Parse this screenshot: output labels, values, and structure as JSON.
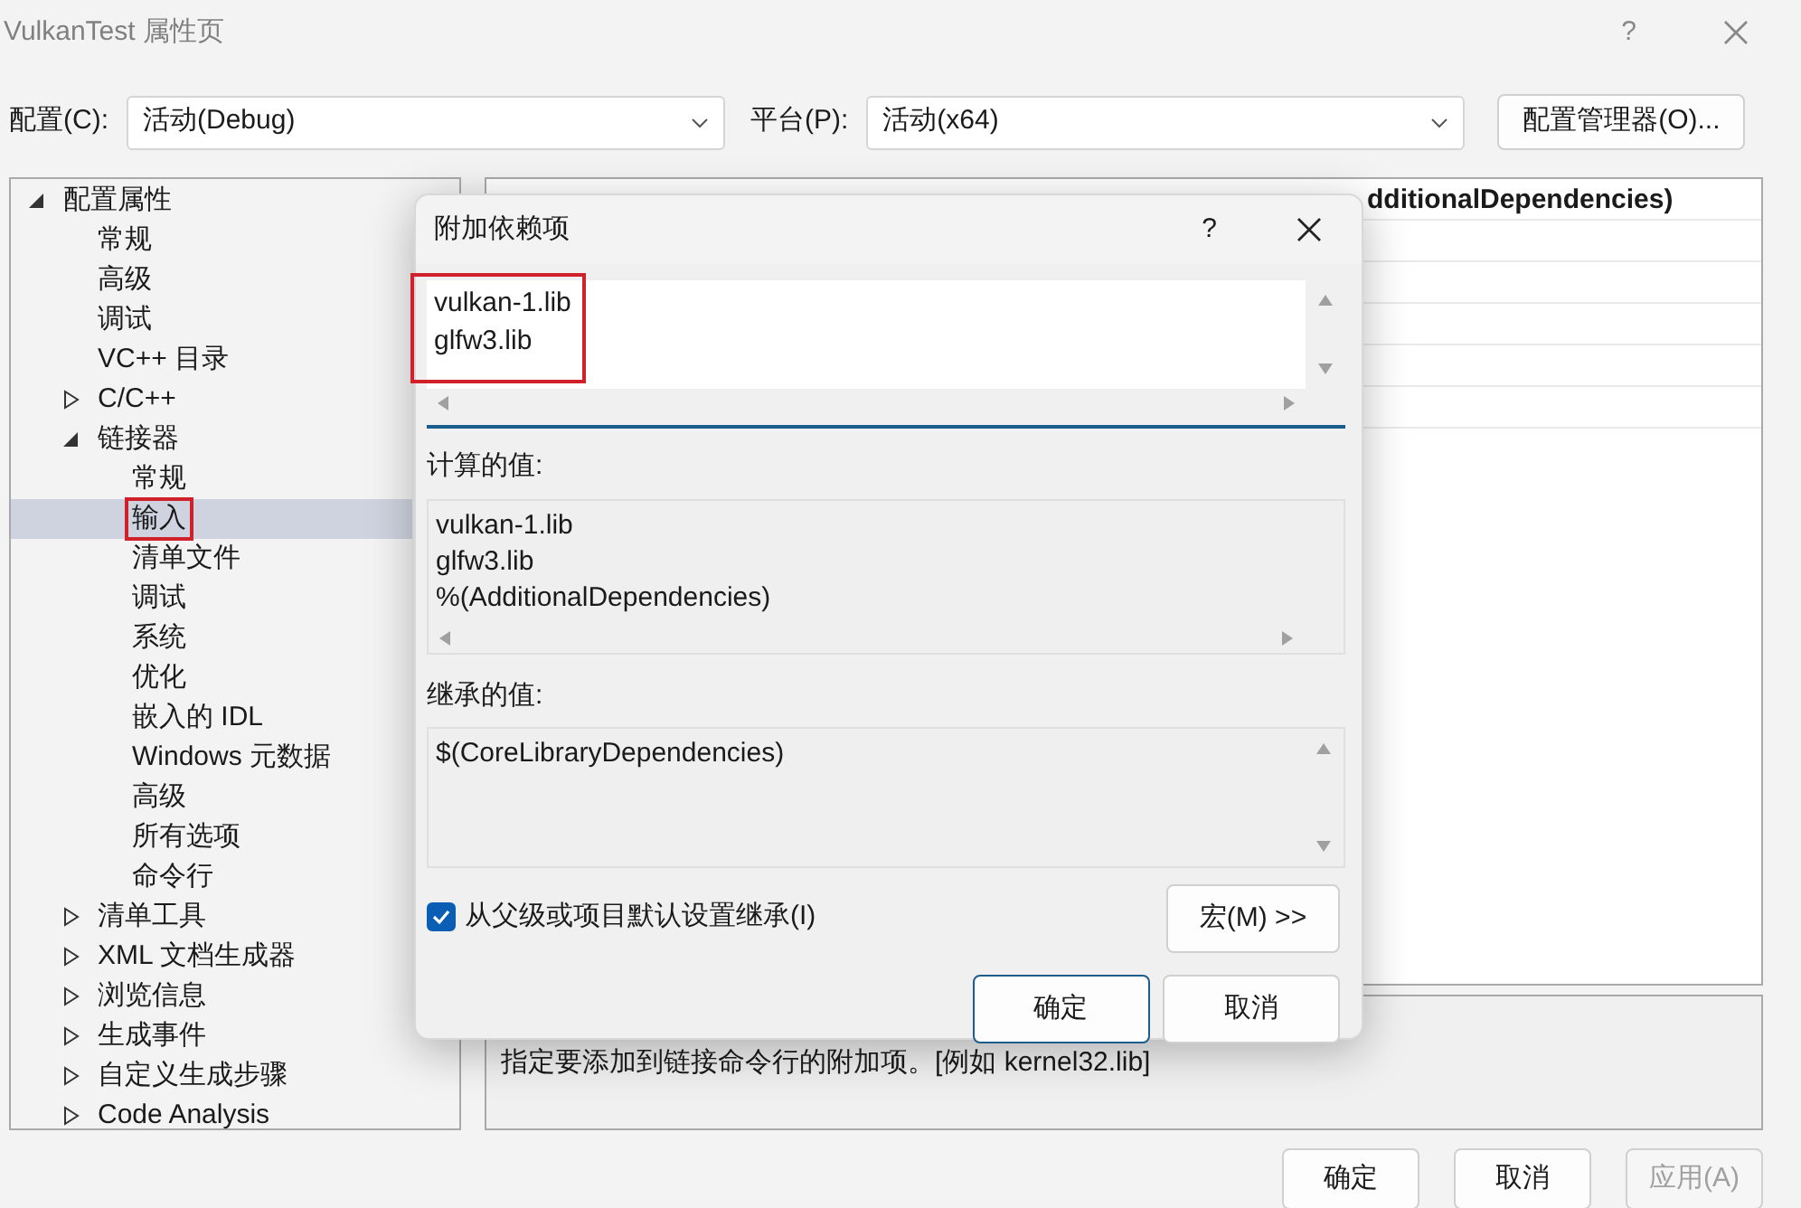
{
  "window": {
    "title": "VulkanTest 属性页",
    "help": "?"
  },
  "configuration": {
    "label": "配置(C):",
    "value": "活动(Debug)"
  },
  "platform": {
    "label": "平台(P):",
    "value": "活动(x64)"
  },
  "config_manager_button": "配置管理器(O)...",
  "tree": [
    {
      "label": "配置属性",
      "expanded": true,
      "selected": false,
      "children": [
        {
          "label": "常规",
          "selected": false
        },
        {
          "label": "高级",
          "selected": false
        },
        {
          "label": "调试",
          "selected": false
        },
        {
          "label": "VC++ 目录",
          "selected": false
        },
        {
          "label": "C/C++",
          "expanded": false,
          "selected": false
        },
        {
          "label": "链接器",
          "expanded": true,
          "selected": false,
          "children": [
            {
              "label": "常规",
              "selected": false
            },
            {
              "label": "输入",
              "selected": true,
              "annotated": true
            },
            {
              "label": "清单文件",
              "selected": false
            },
            {
              "label": "调试",
              "selected": false
            },
            {
              "label": "系统",
              "selected": false
            },
            {
              "label": "优化",
              "selected": false
            },
            {
              "label": "嵌入的 IDL",
              "selected": false
            },
            {
              "label": "Windows 元数据",
              "selected": false
            },
            {
              "label": "高级",
              "selected": false
            },
            {
              "label": "所有选项",
              "selected": false
            },
            {
              "label": "命令行",
              "selected": false
            }
          ]
        },
        {
          "label": "清单工具",
          "expanded": false,
          "selected": false
        },
        {
          "label": "XML 文档生成器",
          "expanded": false,
          "selected": false
        },
        {
          "label": "浏览信息",
          "expanded": false,
          "selected": false
        },
        {
          "label": "生成事件",
          "expanded": false,
          "selected": false
        },
        {
          "label": "自定义生成步骤",
          "expanded": false,
          "selected": false
        },
        {
          "label": "Code Analysis",
          "expanded": false,
          "selected": false
        }
      ]
    }
  ],
  "property_grid": {
    "visible_value": "dditionalDependencies)"
  },
  "description": "指定要添加到链接命令行的附加项。[例如 kernel32.lib]",
  "buttons": [
    {
      "label": "确定",
      "disabled": false
    },
    {
      "label": "取消",
      "disabled": false
    },
    {
      "label": "应用(A)",
      "disabled": true
    }
  ],
  "dialog": {
    "title": "附加依赖项",
    "help": "?",
    "value_lines": [
      "vulkan-1.lib",
      "glfw3.lib"
    ],
    "value_annotated": true,
    "computed_label": "计算的值:",
    "computed_lines": [
      "vulkan-1.lib",
      "glfw3.lib",
      "%(AdditionalDependencies)"
    ],
    "inherited_label": "继承的值:",
    "inherited_lines": [
      "$(CoreLibraryDependencies)"
    ],
    "inherit_checkbox": {
      "label": "从父级或项目默认设置继承(I)",
      "checked": true
    },
    "macros_button": "宏(M) >>",
    "buttons": [
      {
        "label": "确定",
        "default": true
      },
      {
        "label": "取消",
        "default": false
      }
    ]
  }
}
